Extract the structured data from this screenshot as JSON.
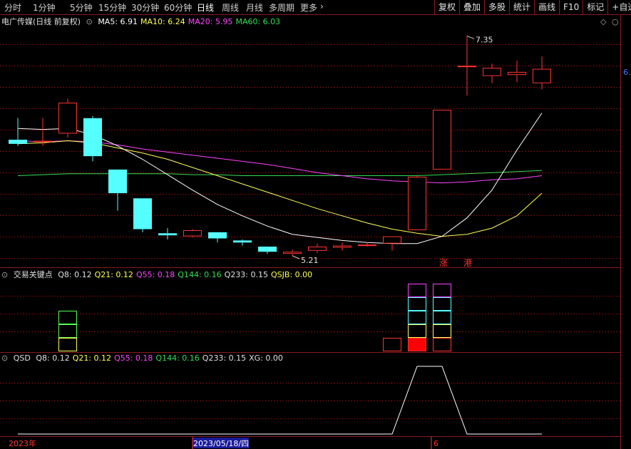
{
  "toolbar": {
    "left_tabs": [
      "分时",
      "1分钟",
      "5分钟",
      "15分钟",
      "30分钟",
      "60分钟",
      "日线",
      "周线",
      "月线",
      "多周期",
      "更多"
    ],
    "active_tab": "日线",
    "right_buttons": [
      "复权",
      "叠加",
      "多股",
      "统计",
      "画线",
      "F10",
      "标记",
      "+自选"
    ]
  },
  "main_panel": {
    "title": "电广传媒(日线 前复权)",
    "ma_labels": [
      {
        "label": "MA5: 6.91",
        "color": "#ffffff"
      },
      {
        "label": "MA10: 6.24",
        "color": "#ffff55"
      },
      {
        "label": "MA20: 5.95",
        "color": "#ff44ff"
      },
      {
        "label": "MA60: 6.03",
        "color": "#33dd55"
      }
    ],
    "high_annotation": "7.35",
    "low_annotation": "5.21",
    "right_price_tag": "6.",
    "markers": [
      "涨",
      "港"
    ],
    "corner_icons": [
      "diamond-icon",
      "close-icon"
    ]
  },
  "panel2": {
    "title": "交易关键点",
    "values": [
      {
        "label": "Q8: 0.12",
        "color": "#e0e0e0"
      },
      {
        "label": "Q21: 0.12",
        "color": "#ffff55"
      },
      {
        "label": "Q55: 0.18",
        "color": "#ff44ff"
      },
      {
        "label": "Q144: 0.16",
        "color": "#33dd55"
      },
      {
        "label": "Q233: 0.15",
        "color": "#e0e0e0"
      },
      {
        "label": "QSJB: 0.00",
        "color": "#ffff55"
      }
    ]
  },
  "panel3": {
    "title": "QSD",
    "values": [
      {
        "label": "Q8: 0.12",
        "color": "#e0e0e0"
      },
      {
        "label": "Q21: 0.12",
        "color": "#ffff55"
      },
      {
        "label": "Q55: 0.18",
        "color": "#ff44ff"
      },
      {
        "label": "Q144: 0.16",
        "color": "#33dd55"
      },
      {
        "label": "Q233: 0.15",
        "color": "#e0e0e0"
      },
      {
        "label": "XG: 0.00",
        "color": "#e0e0e0"
      }
    ]
  },
  "date_axis": {
    "labels": [
      "2023年",
      "2023/05/18/四",
      "6"
    ]
  },
  "colors": {
    "up": "#ff3333",
    "down": "#55ffff",
    "grid": "#7a0a0a",
    "border": "#8b1a1a",
    "ma5": "#ffffff",
    "ma10": "#ffff55",
    "ma20": "#ff44ff",
    "ma60": "#33dd55"
  },
  "chart_data": {
    "type": "candlestick",
    "candles": [
      {
        "o": 6.34,
        "h": 6.55,
        "l": 6.28,
        "c": 6.3
      },
      {
        "o": 6.32,
        "h": 6.55,
        "l": 6.28,
        "c": 6.33
      },
      {
        "o": 6.4,
        "h": 6.74,
        "l": 6.36,
        "c": 6.7
      },
      {
        "o": 6.55,
        "h": 6.57,
        "l": 6.13,
        "c": 6.18
      },
      {
        "o": 6.05,
        "h": 6.05,
        "l": 5.65,
        "c": 5.82
      },
      {
        "o": 5.77,
        "h": 5.77,
        "l": 5.44,
        "c": 5.47
      },
      {
        "o": 5.43,
        "h": 5.48,
        "l": 5.37,
        "c": 5.41
      },
      {
        "o": 5.4,
        "h": 5.47,
        "l": 5.39,
        "c": 5.46
      },
      {
        "o": 5.44,
        "h": 5.44,
        "l": 5.34,
        "c": 5.38
      },
      {
        "o": 5.36,
        "h": 5.37,
        "l": 5.31,
        "c": 5.34
      },
      {
        "o": 5.3,
        "h": 5.3,
        "l": 5.23,
        "c": 5.25
      },
      {
        "o": 5.23,
        "h": 5.27,
        "l": 5.21,
        "c": 5.25
      },
      {
        "o": 5.26,
        "h": 5.33,
        "l": 5.24,
        "c": 5.3
      },
      {
        "o": 5.29,
        "h": 5.34,
        "l": 5.26,
        "c": 5.31
      },
      {
        "o": 5.31,
        "h": 5.34,
        "l": 5.3,
        "c": 5.32
      },
      {
        "o": 5.33,
        "h": 5.4,
        "l": 5.26,
        "c": 5.4
      },
      {
        "o": 5.46,
        "h": 5.99,
        "l": 5.46,
        "c": 5.98
      },
      {
        "o": 6.05,
        "h": 6.63,
        "l": 6.05,
        "c": 6.63
      },
      {
        "o": 7.06,
        "h": 7.35,
        "l": 6.77,
        "c": 7.06
      },
      {
        "o": 6.96,
        "h": 7.08,
        "l": 6.89,
        "c": 7.04
      },
      {
        "o": 6.97,
        "h": 7.11,
        "l": 6.9,
        "c": 7.0
      },
      {
        "o": 6.89,
        "h": 7.15,
        "l": 6.83,
        "c": 7.03
      }
    ],
    "ma5": [
      6.45,
      6.44,
      6.45,
      6.39,
      6.28,
      6.15,
      6.0,
      5.85,
      5.71,
      5.6,
      5.5,
      5.42,
      5.39,
      5.36,
      5.34,
      5.33,
      5.33,
      5.4,
      5.58,
      5.85,
      6.24,
      6.6
    ],
    "ma10": [
      6.3,
      6.31,
      6.33,
      6.31,
      6.26,
      6.21,
      6.15,
      6.07,
      5.99,
      5.91,
      5.83,
      5.75,
      5.67,
      5.6,
      5.53,
      5.47,
      5.43,
      5.4,
      5.42,
      5.48,
      5.6,
      5.82
    ],
    "ma20": [
      6.33,
      6.32,
      6.33,
      6.32,
      6.29,
      6.25,
      6.22,
      6.19,
      6.16,
      6.13,
      6.1,
      6.06,
      6.02,
      5.99,
      5.96,
      5.94,
      5.93,
      5.92,
      5.93,
      5.95,
      5.96,
      5.99
    ],
    "ma60": [
      5.99,
      6.0,
      6.01,
      6.01,
      6.01,
      6.01,
      6.01,
      6.0,
      6.0,
      5.99,
      5.99,
      5.99,
      5.99,
      5.99,
      5.99,
      5.99,
      5.99,
      6.0,
      6.01,
      6.02,
      6.03,
      6.04
    ],
    "ylim": [
      5.12,
      7.45
    ],
    "signal_bars": [
      {
        "index": 2,
        "levels": 3,
        "base": "#000000",
        "colors": [
          "#ffff55",
          "#55ff55",
          "#55ff55"
        ]
      },
      {
        "index": 15,
        "levels": 1,
        "base": "#000000",
        "colors": [
          "#ff3333"
        ]
      },
      {
        "index": 16,
        "levels": 5,
        "base": "#ff0000",
        "colors": [
          "#ff3333",
          "#ffff55",
          "#55ffff",
          "#55ffff",
          "#ff44ff"
        ]
      },
      {
        "index": 17,
        "levels": 5,
        "base": "#000000",
        "colors": [
          "#ff3333",
          "#ffff55",
          "#55ffff",
          "#55ffff",
          "#ff44ff"
        ]
      }
    ],
    "qsd": [
      0,
      0,
      0,
      0,
      0,
      0,
      0,
      0,
      0,
      0,
      0,
      0,
      0,
      0,
      0,
      0,
      1,
      1,
      0,
      0,
      0,
      0
    ]
  }
}
